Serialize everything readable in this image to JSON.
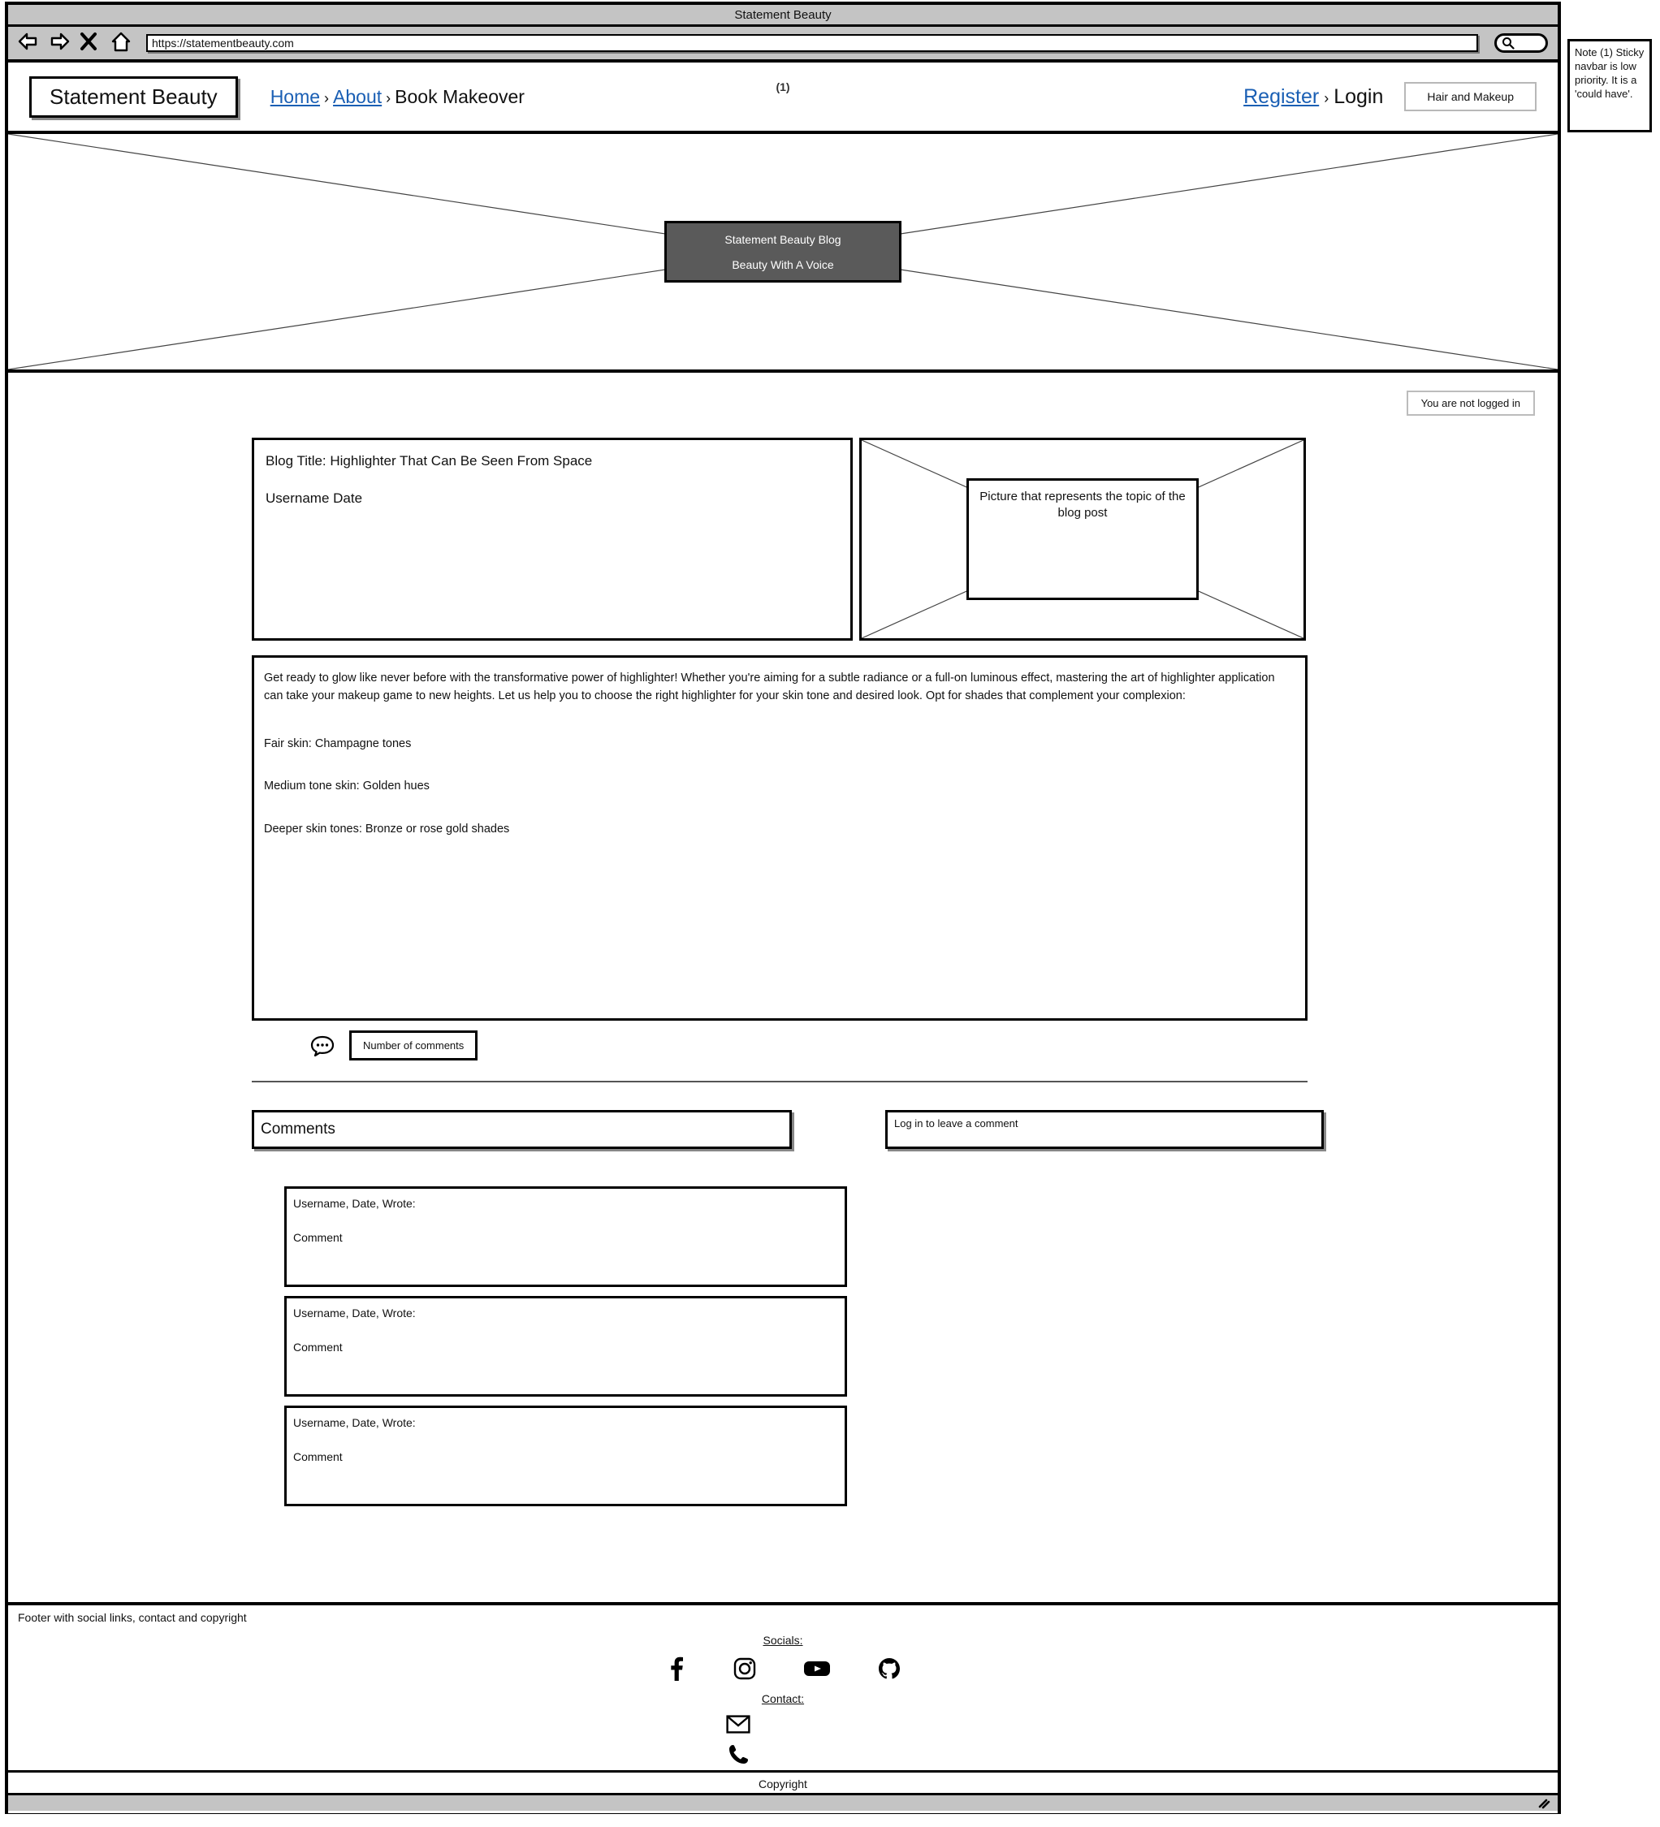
{
  "browser": {
    "title": "Statement Beauty",
    "url": "https://statementbeauty.com",
    "back_icon": "back-arrow-icon",
    "forward_icon": "forward-arrow-icon",
    "stop_icon": "close-x-icon",
    "home_icon": "home-icon",
    "search_icon": "search-icon"
  },
  "annotation": {
    "marker": "(1)",
    "note": "Note (1) Sticky navbar is low priority. It is a 'could have'."
  },
  "navbar": {
    "logo": "Statement Beauty",
    "breadcrumb": [
      {
        "label": "Home",
        "link": true
      },
      {
        "label": "About",
        "link": true
      },
      {
        "label": "Book Makeover",
        "link": false
      }
    ],
    "separator": "›",
    "auth": [
      {
        "label": "Register",
        "link": true
      },
      {
        "label": "Login",
        "link": false
      }
    ],
    "cta_button": "Hair and Makeup"
  },
  "hero": {
    "title": "Statement Beauty Blog",
    "subtitle": "Beauty With A Voice"
  },
  "main": {
    "login_status": "You are not logged in",
    "post": {
      "title": "Blog Title: Highlighter That Can Be Seen From Space",
      "meta": "Username Date",
      "image_placeholder": "Picture that represents the topic of the blog post",
      "paragraph": "Get ready to glow like never before with the transformative power of highlighter! Whether you're aiming for a subtle radiance or a full-on luminous effect, mastering the art of highlighter application can take your makeup game to new heights. Let us help you to choose the right highlighter for your skin tone and desired look. Opt for shades that complement your complexion:",
      "tips": [
        "Fair skin: Champagne tones",
        "Medium tone skin: Golden hues",
        "Deeper skin tones: Bronze or rose gold shades"
      ],
      "comment_icon": "comment-bubble-icon",
      "comment_count_label": "Number of comments"
    },
    "comments_section": {
      "heading": "Comments",
      "login_prompt": "Log in to leave a comment",
      "items": [
        {
          "head": "Username, Date, Wrote:",
          "body": "Comment"
        },
        {
          "head": "Username, Date, Wrote:",
          "body": "Comment"
        },
        {
          "head": "Username, Date, Wrote:",
          "body": "Comment"
        }
      ]
    }
  },
  "footer": {
    "label": "Footer with social links, contact and copyright",
    "socials_heading": "Socials:",
    "socials": [
      {
        "name": "facebook-icon"
      },
      {
        "name": "instagram-icon"
      },
      {
        "name": "youtube-icon"
      },
      {
        "name": "github-icon"
      }
    ],
    "contact_heading": "Contact:",
    "contact": [
      {
        "name": "email-icon"
      },
      {
        "name": "phone-icon"
      }
    ],
    "copyright": "Copyright"
  },
  "colors": {
    "chrome_gray": "#c4c4c4",
    "hero_fill": "#5a5a5a",
    "link_blue": "#1a5fb4",
    "outline_black": "#000000"
  }
}
